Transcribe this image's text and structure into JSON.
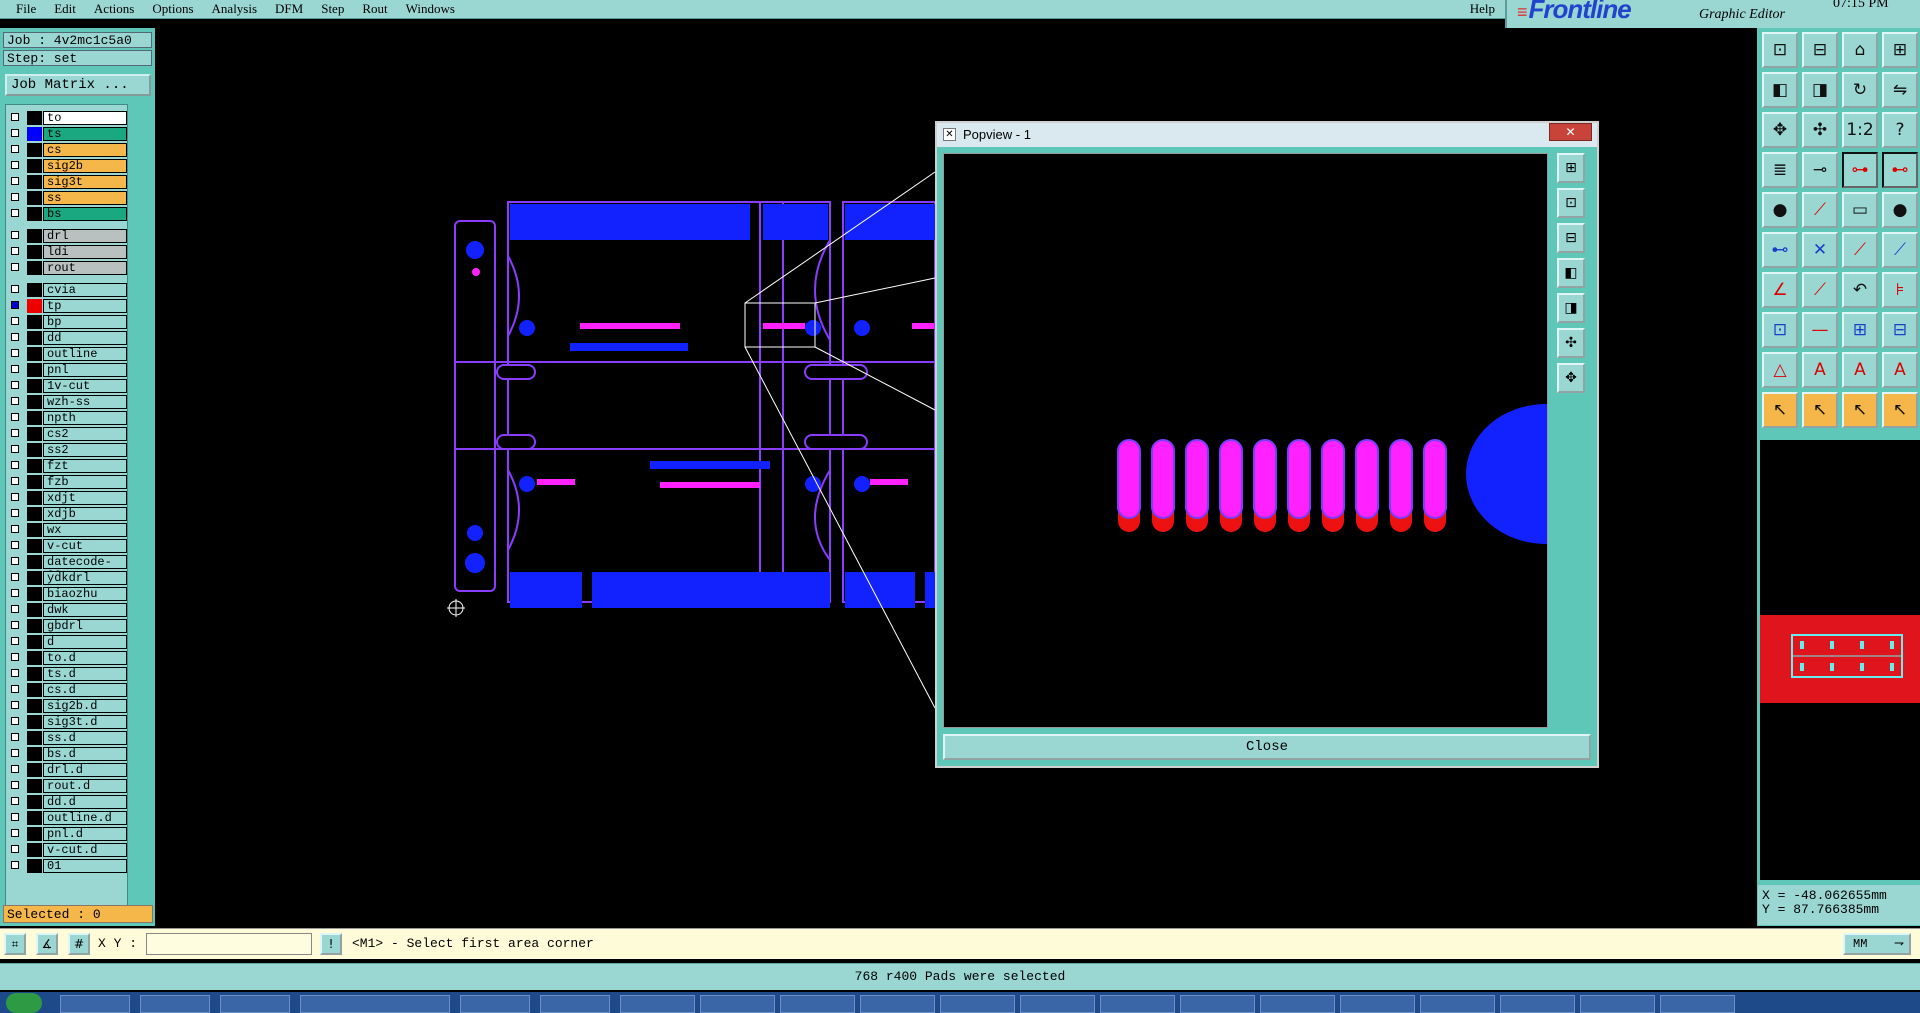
{
  "menubar": {
    "items": [
      "File",
      "Edit",
      "Actions",
      "Options",
      "Analysis",
      "DFM",
      "Step",
      "Rout",
      "Windows"
    ],
    "help": "Help"
  },
  "brand": {
    "logo": "Frontline",
    "subtitle": "Graphic Editor",
    "time": "07:15 PM"
  },
  "job": {
    "job_label": "Job : 4v2mc1c5a0",
    "step_label": "Step: set",
    "matrix_button": "Job Matrix ..."
  },
  "layers": [
    {
      "name": "to",
      "style": "white",
      "swatch": "black",
      "checked": false
    },
    {
      "name": "ts",
      "style": "sel-green",
      "swatch": "blue",
      "checked": false
    },
    {
      "name": "cs",
      "style": "orange",
      "swatch": "black",
      "checked": false
    },
    {
      "name": "sig2b",
      "style": "orange",
      "swatch": "black",
      "checked": false
    },
    {
      "name": "sig3t",
      "style": "orange",
      "swatch": "black",
      "checked": false
    },
    {
      "name": "ss",
      "style": "orange",
      "swatch": "black",
      "checked": false
    },
    {
      "name": "bs",
      "style": "sel-green",
      "swatch": "black",
      "checked": false
    },
    {
      "name": "drl",
      "style": "grey",
      "swatch": "black",
      "checked": false
    },
    {
      "name": "ldi",
      "style": "grey",
      "swatch": "black",
      "checked": false
    },
    {
      "name": "rout",
      "style": "grey",
      "swatch": "black",
      "checked": false
    },
    {
      "name": "cvia",
      "style": "",
      "swatch": "black",
      "checked": false
    },
    {
      "name": "tp",
      "style": "",
      "swatch": "red",
      "checked": true
    },
    {
      "name": "bp",
      "style": "",
      "swatch": "black",
      "checked": false
    },
    {
      "name": "dd",
      "style": "",
      "swatch": "black",
      "checked": false
    },
    {
      "name": "outline",
      "style": "",
      "swatch": "black",
      "checked": false
    },
    {
      "name": "pnl",
      "style": "",
      "swatch": "black",
      "checked": false
    },
    {
      "name": "1v-cut",
      "style": "",
      "swatch": "black",
      "checked": false
    },
    {
      "name": "wzh-ss",
      "style": "",
      "swatch": "black",
      "checked": false
    },
    {
      "name": "npth",
      "style": "",
      "swatch": "black",
      "checked": false
    },
    {
      "name": "cs2",
      "style": "",
      "swatch": "black",
      "checked": false
    },
    {
      "name": "ss2",
      "style": "",
      "swatch": "black",
      "checked": false
    },
    {
      "name": "fzt",
      "style": "",
      "swatch": "black",
      "checked": false
    },
    {
      "name": "fzb",
      "style": "",
      "swatch": "black",
      "checked": false
    },
    {
      "name": "xdjt",
      "style": "",
      "swatch": "black",
      "checked": false
    },
    {
      "name": "xdjb",
      "style": "",
      "swatch": "black",
      "checked": false
    },
    {
      "name": "wx",
      "style": "",
      "swatch": "black",
      "checked": false
    },
    {
      "name": "v-cut",
      "style": "",
      "swatch": "black",
      "checked": false
    },
    {
      "name": "datecode-ss",
      "style": "",
      "swatch": "black",
      "checked": false
    },
    {
      "name": "ydkdrl",
      "style": "",
      "swatch": "black",
      "checked": false
    },
    {
      "name": "biaozhu",
      "style": "",
      "swatch": "black",
      "checked": false
    },
    {
      "name": "dwk",
      "style": "",
      "swatch": "black",
      "checked": false
    },
    {
      "name": "gbdrl",
      "style": "",
      "swatch": "black",
      "checked": false
    },
    {
      "name": "d",
      "style": "",
      "swatch": "black",
      "checked": false
    },
    {
      "name": "to.d",
      "style": "",
      "swatch": "black",
      "checked": false
    },
    {
      "name": "ts.d",
      "style": "",
      "swatch": "black",
      "checked": false
    },
    {
      "name": "cs.d",
      "style": "",
      "swatch": "black",
      "checked": false
    },
    {
      "name": "sig2b.d",
      "style": "",
      "swatch": "black",
      "checked": false
    },
    {
      "name": "sig3t.d",
      "style": "",
      "swatch": "black",
      "checked": false
    },
    {
      "name": "ss.d",
      "style": "",
      "swatch": "black",
      "checked": false
    },
    {
      "name": "bs.d",
      "style": "",
      "swatch": "black",
      "checked": false
    },
    {
      "name": "drl.d",
      "style": "",
      "swatch": "black",
      "checked": false
    },
    {
      "name": "rout.d",
      "style": "",
      "swatch": "black",
      "checked": false
    },
    {
      "name": "dd.d",
      "style": "",
      "swatch": "black",
      "checked": false
    },
    {
      "name": "outline.d",
      "style": "",
      "swatch": "black",
      "checked": false
    },
    {
      "name": "pnl.d",
      "style": "",
      "swatch": "black",
      "checked": false
    },
    {
      "name": "v-cut.d",
      "style": "",
      "swatch": "black",
      "checked": false
    },
    {
      "name": "01",
      "style": "",
      "swatch": "black",
      "checked": false
    }
  ],
  "selected_label": "Selected : 0",
  "popview": {
    "title": "Popview - 1",
    "close_label": "Close",
    "close_x": "✕"
  },
  "coords": {
    "x": "X = -48.062655mm",
    "y": "Y = 87.766385mm"
  },
  "command": {
    "xy_label": "X Y :",
    "xy_value": "",
    "prompt": "<M1> - Select first area corner",
    "units": "MM"
  },
  "status": "768 r400 Pads were selected",
  "colors": {
    "panel": "#5fc7b7",
    "field": "#9ad7d3",
    "pad_magenta": "#ff22ff",
    "pad_red": "#ee1111",
    "board_blue": "#1122ff",
    "profile_purple": "#8a3cff"
  }
}
